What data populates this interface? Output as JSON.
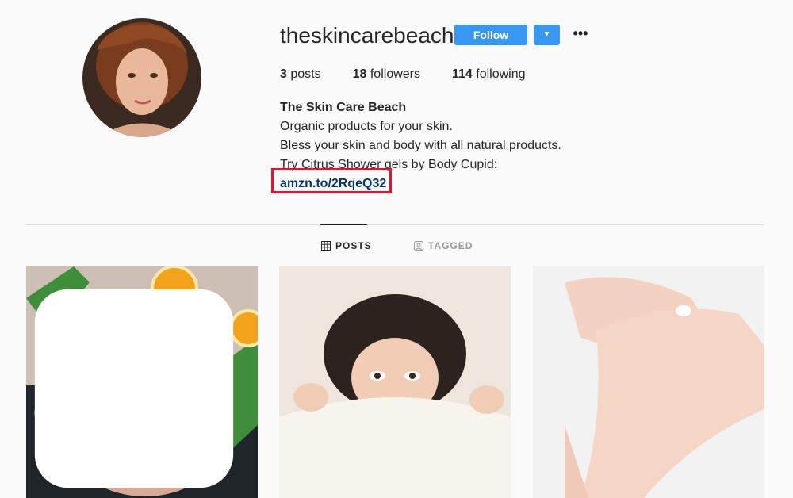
{
  "profile": {
    "username": "theskincarebeach",
    "follow_label": "Follow",
    "dropdown_glyph": "▼",
    "more_glyph": "•••",
    "avatar_icon": "profile-photo"
  },
  "stats": {
    "posts_count": "3",
    "posts_label": "posts",
    "followers_count": "18",
    "followers_label": "followers",
    "following_count": "114",
    "following_label": "following"
  },
  "bio": {
    "name": "The Skin Care Beach",
    "line1": "Organic products for your skin.",
    "line2": "Bless your skin and body with all natural products.",
    "line3": "Try Citrus Shower gels by Body Cupid:",
    "link": "amzn.to/2RqeQ32"
  },
  "tabs": [
    {
      "label": "POSTS",
      "icon": "grid-icon",
      "active": true
    },
    {
      "label": "TAGGED",
      "icon": "tag-icon",
      "active": false
    }
  ],
  "posts": [
    {
      "name": "oranges-bath-photo",
      "multi": true
    },
    {
      "name": "girl-under-blanket-photo",
      "multi": false
    },
    {
      "name": "hand-cream-photo",
      "multi": false
    }
  ],
  "colors": {
    "accent": "#3897f0",
    "link": "#003569",
    "highlight_box": "#e0142e",
    "background": "#fafafa"
  }
}
